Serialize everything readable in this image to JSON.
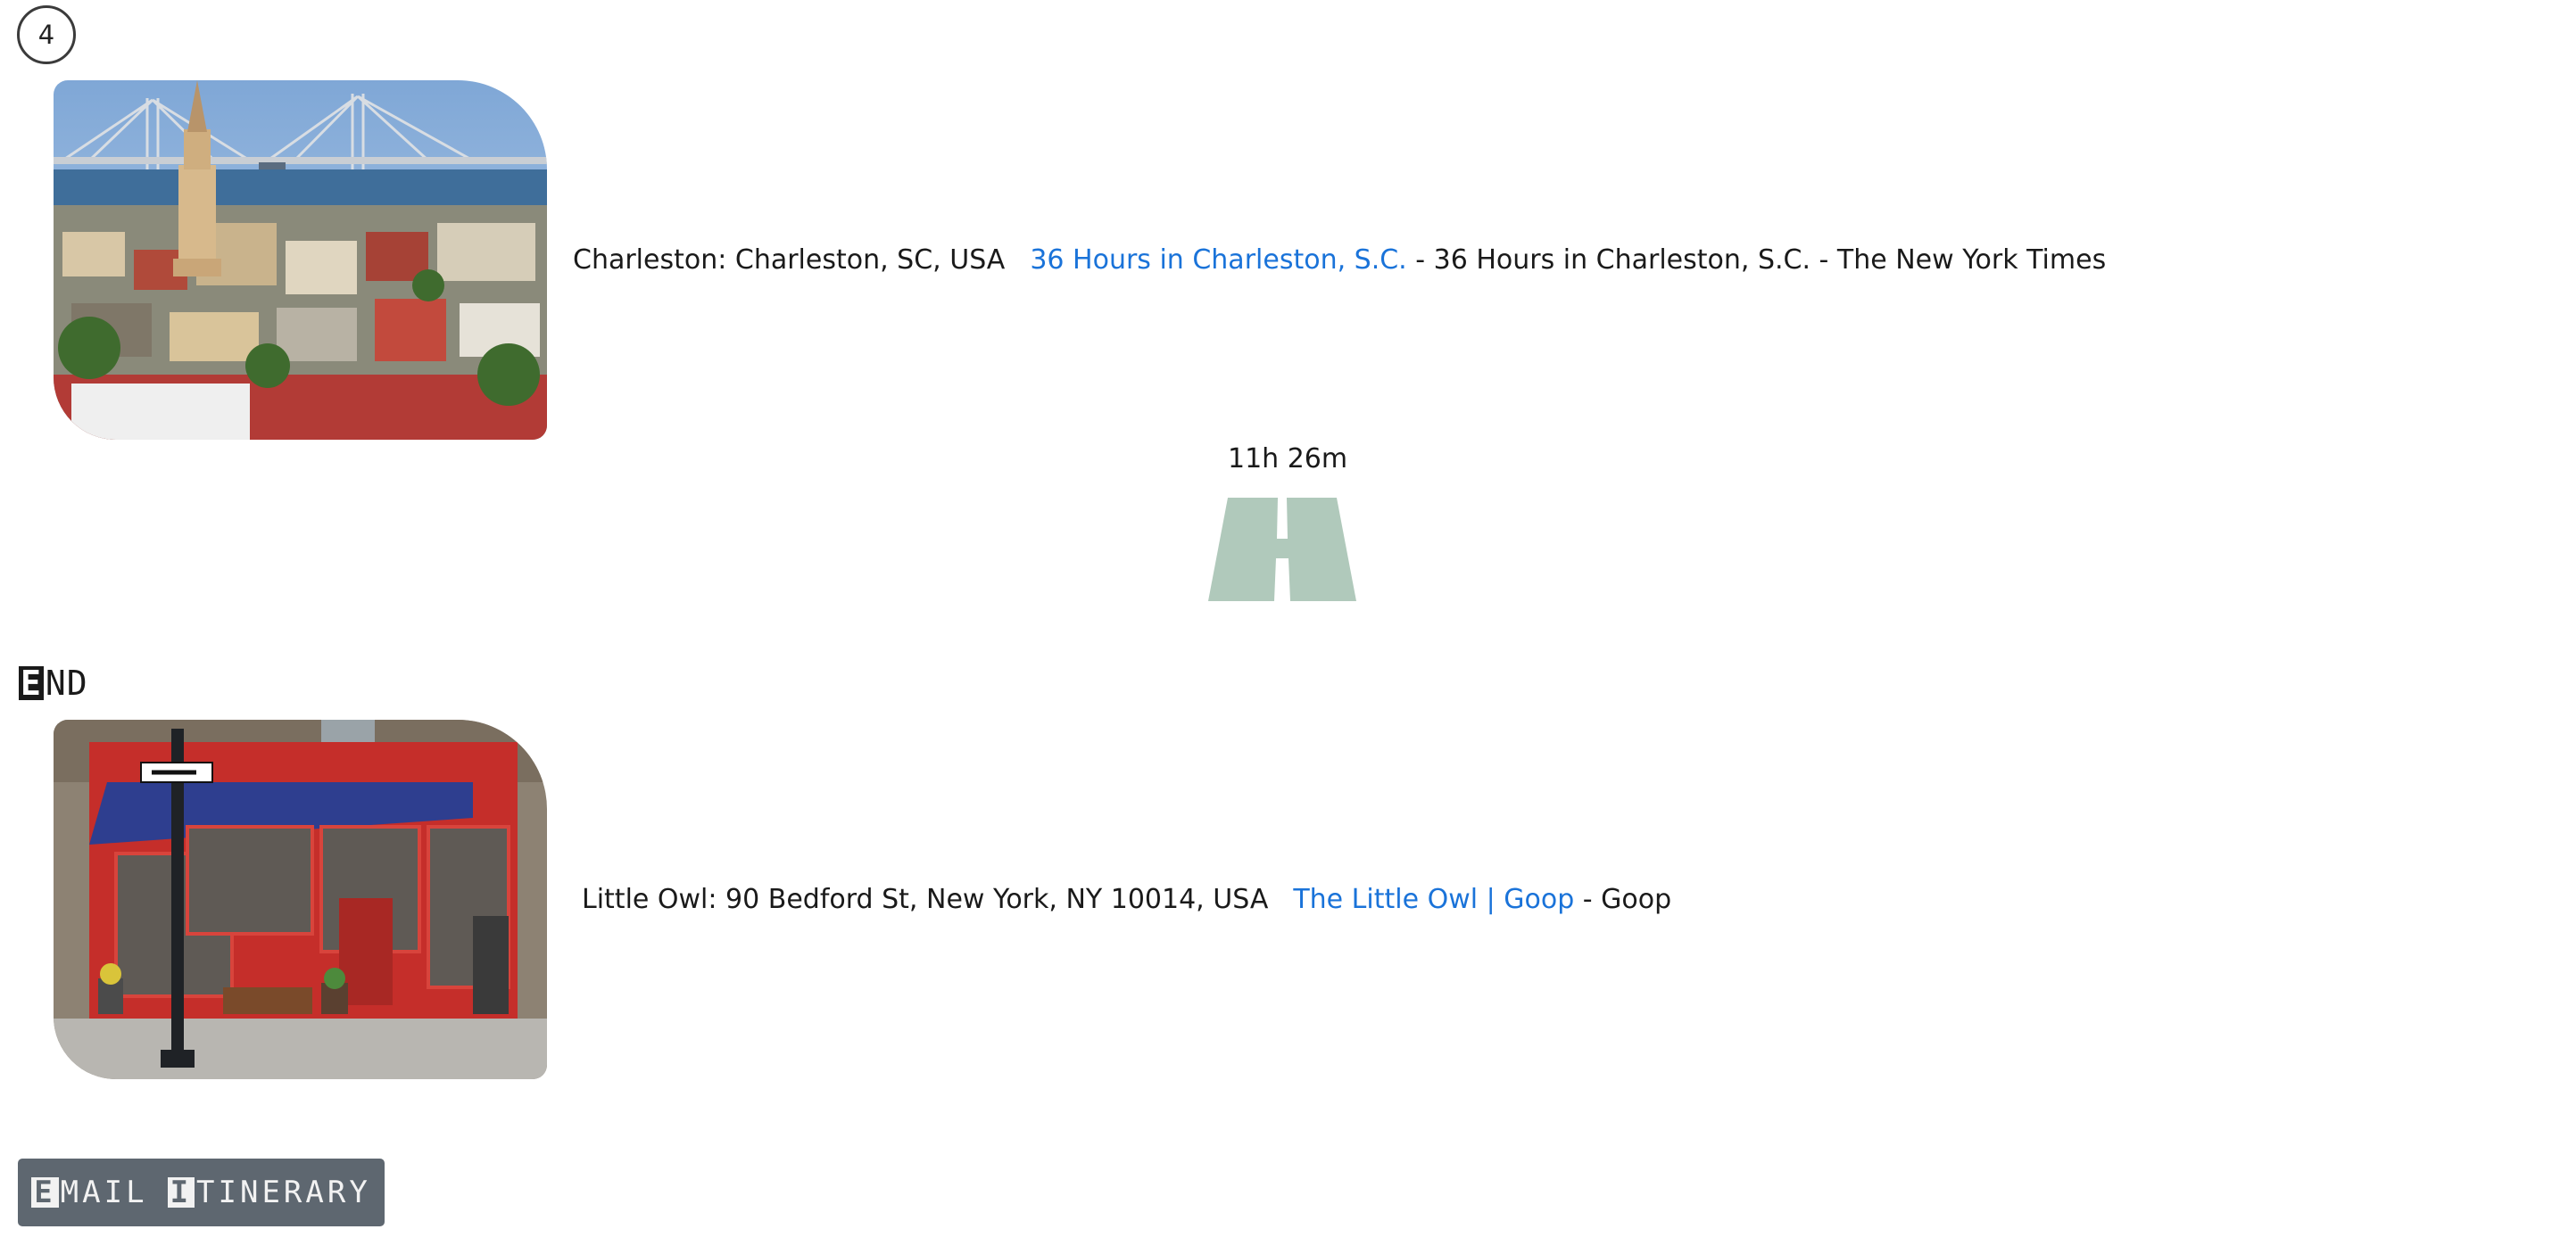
{
  "step": {
    "number": "4"
  },
  "stops": [
    {
      "place_line": "Charleston: Charleston, SC, USA",
      "link_text": "36 Hours in Charleston, S.C.",
      "link_suffix": "- 36 Hours in Charleston, S.C. - The New York Times",
      "photo_icon": "city-skyline-photo"
    },
    {
      "place_line": "Little Owl: 90 Bedford St, New York, NY 10014, USA",
      "link_text": "The Little Owl | Goop",
      "link_suffix": "- Goop",
      "photo_icon": "restaurant-storefront-photo"
    }
  ],
  "travel": {
    "duration": "11h 26m",
    "icon": "road-icon"
  },
  "end_section": {
    "heading_first": "E",
    "heading_rest": "ND"
  },
  "email_button": {
    "first_word_initial": "E",
    "first_word_rest": "MAIL",
    "second_word_initial": "I",
    "second_word_rest": "TINERARY"
  },
  "colors": {
    "link": "#1a73d9",
    "road": "#b0c9bb",
    "button_bg": "#5e6770"
  }
}
